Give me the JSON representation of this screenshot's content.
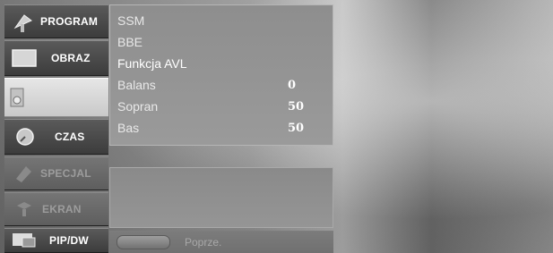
{
  "side_menu": {
    "items": [
      {
        "label": "PROGRAM",
        "icon": "satellite-dish-icon",
        "state": "normal"
      },
      {
        "label": "OBRAZ",
        "icon": "picture-icon",
        "state": "normal"
      },
      {
        "label": "",
        "icon": "speaker-icon",
        "state": "selected"
      },
      {
        "label": "CZAS",
        "icon": "clock-icon",
        "state": "normal"
      },
      {
        "label": "SPECJAL",
        "icon": "special-icon",
        "state": "disabled"
      },
      {
        "label": "EKRAN",
        "icon": "screen-icon",
        "state": "disabled"
      },
      {
        "label": "PIP/DW",
        "icon": "pip-icon",
        "state": "normal"
      }
    ]
  },
  "sound_menu": {
    "rows": [
      {
        "label": "SSM",
        "value": ""
      },
      {
        "label": "BBE",
        "value": ""
      },
      {
        "label": "Funkcja AVL",
        "value": ""
      },
      {
        "label": "Balans",
        "value": "0"
      },
      {
        "label": "Sopran",
        "value": "50"
      },
      {
        "label": "Bas",
        "value": "50"
      }
    ]
  },
  "hint": {
    "text": "Poprze."
  },
  "colors": {
    "menu_dark": "#3c3c3c",
    "menu_selected": "#d8d8d8",
    "panel": "#929292",
    "text": "#ffffff"
  }
}
